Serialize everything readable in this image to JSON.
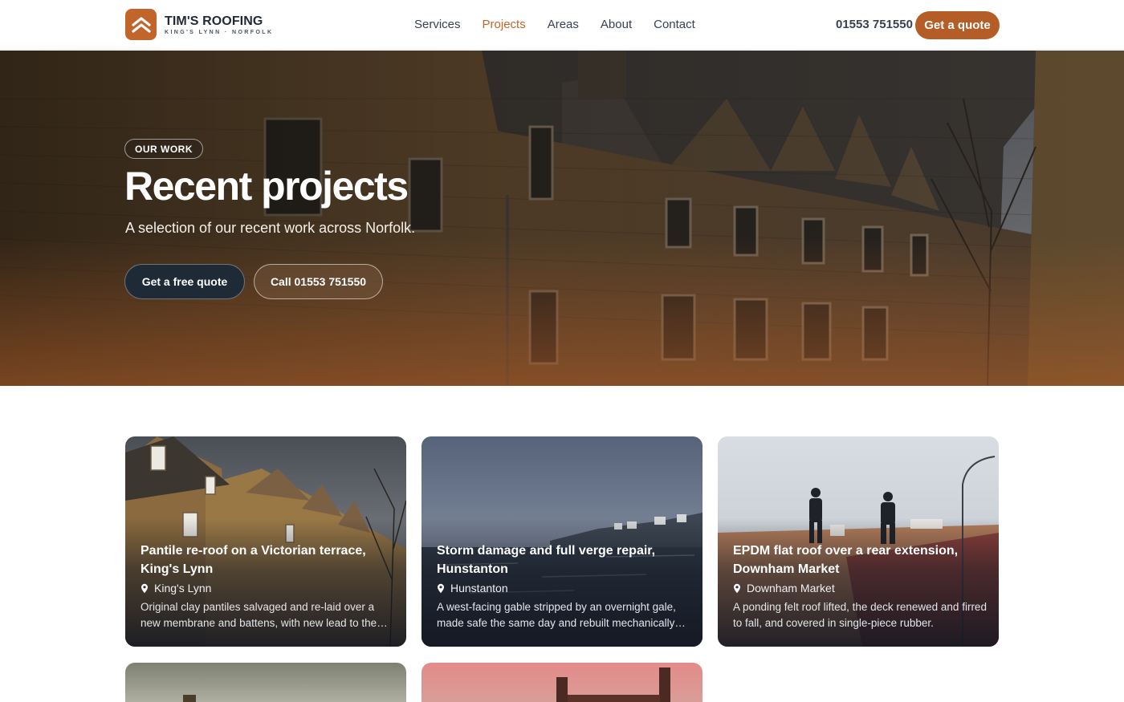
{
  "brand": {
    "name": "TIM'S ROOFING",
    "tagline": "KING'S LYNN · NORFOLK",
    "accent": "#c2652a"
  },
  "nav": {
    "items": [
      {
        "label": "Services",
        "active": false
      },
      {
        "label": "Projects",
        "active": true
      },
      {
        "label": "Areas",
        "active": false
      },
      {
        "label": "About",
        "active": false
      },
      {
        "label": "Contact",
        "active": false
      }
    ],
    "phone": "01553 751550",
    "cta": "Get a quote"
  },
  "hero": {
    "badge": "OUR WORK",
    "title": "Recent projects",
    "subtitle": "A selection of our recent work across Norfolk.",
    "primary_cta": "Get a free quote",
    "secondary_cta": "Call 01553 751550"
  },
  "projects": [
    {
      "title": "Pantile re-roof on a Victorian terrace, King's Lynn",
      "location": "King's Lynn",
      "description": "Original clay pantiles salvaged and re-laid over a new membrane and battens, with new lead to the chimney and valleys."
    },
    {
      "title": "Storm damage and full verge repair, Hunstanton",
      "location": "Hunstanton",
      "description": "A west-facing gable stripped by an overnight gale, made safe the same day and rebuilt mechanically fixed."
    },
    {
      "title": "EPDM flat roof over a rear extension, Downham Market",
      "location": "Downham Market",
      "description": "A ponding felt roof lifted, the deck renewed and firred to fall, and covered in single-piece rubber."
    }
  ]
}
